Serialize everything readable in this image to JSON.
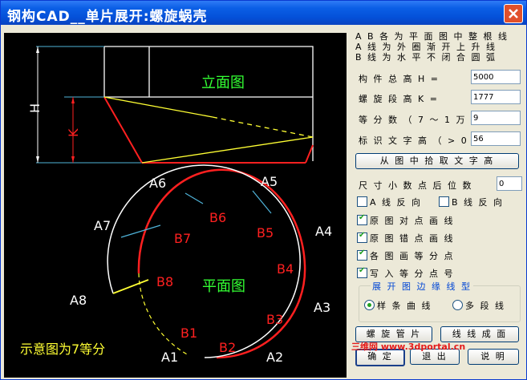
{
  "window": {
    "title": "钢构CAD__单片展开:螺旋蜗壳"
  },
  "diagram": {
    "elevation_label": "立面图",
    "plan_label": "平面图",
    "note": "示意图为7等分",
    "h_label": "H",
    "k_label": "K",
    "a_labels": [
      "A1",
      "A2",
      "A3",
      "A4",
      "A5",
      "A6",
      "A7",
      "A8"
    ],
    "b_labels": [
      "B1",
      "B2",
      "B3",
      "B4",
      "B5",
      "B6",
      "B7",
      "B8"
    ]
  },
  "panel": {
    "info_lines": [
      "A B 各 为 平 面 图 中 整 根 线",
      "A 线 为 外 圈 渐 开 上 升 线",
      "B 线 为 水 平 不 闭 合 圆 弧"
    ],
    "fields": [
      {
        "label": "构 件 总 高 H =",
        "value": "5000"
      },
      {
        "label": "螺 旋 段 高 K =",
        "value": "1777"
      },
      {
        "label": "等 分 数 （ 7 ～ 1 万 ）",
        "value": "9"
      },
      {
        "label": "标 识 文 字 高 （ > 0 ）",
        "value": "56"
      }
    ],
    "pick_text_height_button": "从 图 中 拾 取 文 字 高",
    "decimal_label": "尺 寸 小 数 点 后 位 数",
    "decimal_value": "0",
    "reverse_a": "A 线 反 向",
    "reverse_b": "B 线 反 向",
    "checks": [
      {
        "label": "原 图 对 点 画 线",
        "checked": true
      },
      {
        "label": "原 图 错 点 画 线",
        "checked": true
      },
      {
        "label": "各 图 画 等 分 点",
        "checked": true
      },
      {
        "label": "写 入 等 分 点 号",
        "checked": true
      }
    ],
    "edge_group_title": "展 开 图 边 缘 线 型",
    "radio_spline": "样 条 曲 线",
    "radio_polyline": "多 段 线",
    "spiral_pipe_button": "螺 旋 管 片",
    "line_surface_button": "线 线 成 面",
    "ok_button": "确 定",
    "exit_button": "退 出",
    "help_button": "说 明"
  },
  "watermark": "三维网 www.3dportal.cn",
  "colors": {
    "title_bar": "#0450d8",
    "canvas_bg": "#000000",
    "b_line": "#ff0000",
    "a_line": "#ffffff"
  }
}
